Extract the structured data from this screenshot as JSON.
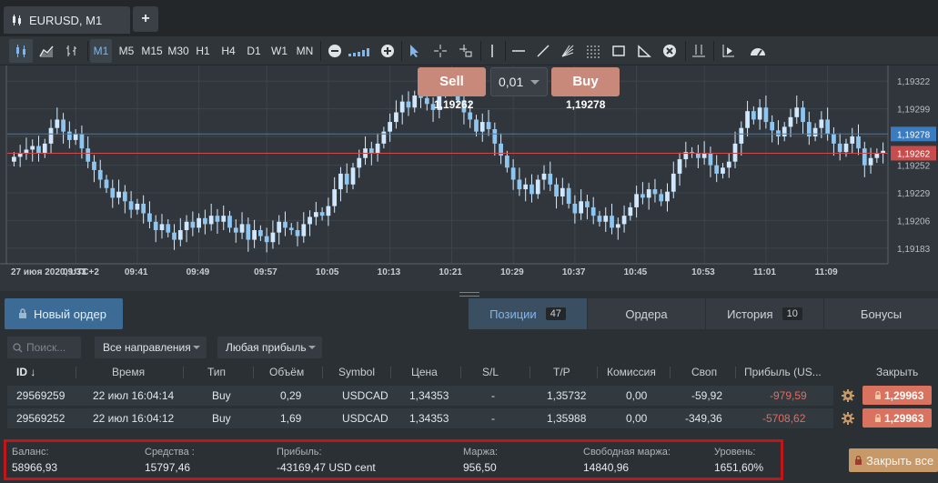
{
  "tab": {
    "title": "EURUSD, M1",
    "close": "×",
    "new_tab": "+"
  },
  "toolbar": {
    "timeframes": [
      "M1",
      "M5",
      "M15",
      "M30",
      "H1",
      "H4",
      "D1",
      "W1",
      "MN"
    ],
    "active_timeframe": "M1"
  },
  "trade": {
    "sell_label": "Sell",
    "buy_label": "Buy",
    "lot": "0,01",
    "sell_price": "1,19262",
    "buy_price": "1,19278"
  },
  "chart_data": {
    "type": "candlestick",
    "symbol": "EURUSD",
    "timeframe": "M1",
    "x_ticks": [
      "27 июя 2020, UTC+2",
      "09:33",
      "09:41",
      "09:49",
      "09:57",
      "10:05",
      "10:13",
      "10:21",
      "10:29",
      "10:37",
      "10:45",
      "10:53",
      "11:01",
      "11:09"
    ],
    "y_ticks": [
      "1,19322",
      "1,19299",
      "1,19276",
      "1,19252",
      "1,19229",
      "1,19206",
      "1,19183"
    ],
    "ylim": [
      1.1917,
      1.19335
    ],
    "bid_line": "1,19262",
    "ask_line": "1,19278",
    "bid_color": "#c94c4c",
    "ask_color": "#3b7bbf",
    "closes": [
      1.19259,
      1.19262,
      1.19265,
      1.19268,
      1.19262,
      1.1927,
      1.19283,
      1.1929,
      1.1928,
      1.19273,
      1.19278,
      1.19266,
      1.19255,
      1.19248,
      1.1924,
      1.19233,
      1.19225,
      1.1923,
      1.19222,
      1.19215,
      1.1922,
      1.19212,
      1.19205,
      1.19198,
      1.19203,
      1.19196,
      1.1919,
      1.19198,
      1.19205,
      1.192,
      1.19208,
      1.19203,
      1.1921,
      1.19205,
      1.1921,
      1.192,
      1.19196,
      1.19203,
      1.1919,
      1.19198,
      1.19193,
      1.19188,
      1.19196,
      1.19205,
      1.192,
      1.19198,
      1.19193,
      1.19203,
      1.19209,
      1.19213,
      1.1921,
      1.19218,
      1.19232,
      1.19245,
      1.19236,
      1.1925,
      1.19258,
      1.19266,
      1.19262,
      1.1927,
      1.1928,
      1.19288,
      1.19296,
      1.19305,
      1.193,
      1.1931,
      1.19308,
      1.19303,
      1.19298,
      1.19312,
      1.19322,
      1.19318,
      1.19306,
      1.19296,
      1.1929,
      1.1928,
      1.19288,
      1.19282,
      1.1927,
      1.1926,
      1.1925,
      1.1924,
      1.19232,
      1.19236,
      1.19228,
      1.1924,
      1.19245,
      1.19236,
      1.19226,
      1.19233,
      1.1922,
      1.19212,
      1.19222,
      1.19217,
      1.1921,
      1.19205,
      1.1921,
      1.192,
      1.19203,
      1.1921,
      1.19217,
      1.19228,
      1.19225,
      1.19232,
      1.19228,
      1.19222,
      1.1923,
      1.19245,
      1.19257,
      1.19263,
      1.19262,
      1.19258,
      1.19262,
      1.19252,
      1.19245,
      1.1925,
      1.19255,
      1.1927,
      1.19283,
      1.19297,
      1.1929,
      1.193,
      1.19288,
      1.19281,
      1.19276,
      1.19284,
      1.19292,
      1.193,
      1.19288,
      1.19276,
      1.19283,
      1.1929,
      1.19278,
      1.1927,
      1.19263,
      1.1927,
      1.19276,
      1.19266,
      1.19252,
      1.19258,
      1.19262,
      1.19264
    ]
  },
  "panel": {
    "new_order": "Новый ордер",
    "tabs": [
      {
        "label": "Позиции",
        "count": "47"
      },
      {
        "label": "Ордера",
        "count": ""
      },
      {
        "label": "История",
        "count": "10"
      },
      {
        "label": "Бонусы",
        "count": ""
      }
    ],
    "search_placeholder": "Поиск...",
    "filter_direction": "Все направления",
    "filter_profit": "Любая прибыль",
    "columns": [
      "ID",
      "Время",
      "Тип",
      "Объём",
      "Symbol",
      "Цена",
      "S/L",
      "T/P",
      "Комиссия",
      "Своп",
      "Прибыль (US...",
      "Закрыть"
    ],
    "rows": [
      {
        "id": "29569259",
        "time": "22 июл 16:04:14",
        "type": "Buy",
        "volume": "0,29",
        "symbol": "USDCAD",
        "price": "1,34353",
        "sl": "-",
        "tp": "1,35732",
        "commission": "0,00",
        "swap": "-59,92",
        "profit": "-979,59",
        "close": "1,29963"
      },
      {
        "id": "29569252",
        "time": "22 июл 16:04:12",
        "type": "Buy",
        "volume": "1,69",
        "symbol": "USDCAD",
        "price": "1,34353",
        "sl": "-",
        "tp": "1,35988",
        "commission": "0,00",
        "swap": "-349,36",
        "profit": "-5708,62",
        "close": "1,29963"
      }
    ],
    "summary": {
      "balance_label": "Баланс:",
      "balance": "58966,93",
      "equity_label": "Средства :",
      "equity": "15797,46",
      "profit_label": "Прибыль:",
      "profit": "-43169,47 USD cent",
      "margin_label": "Маржа:",
      "margin": "956,50",
      "free_margin_label": "Свободная маржа:",
      "free_margin": "14840,96",
      "level_label": "Уровень:",
      "level": "1651,60%"
    },
    "close_all": "Закрыть все"
  }
}
